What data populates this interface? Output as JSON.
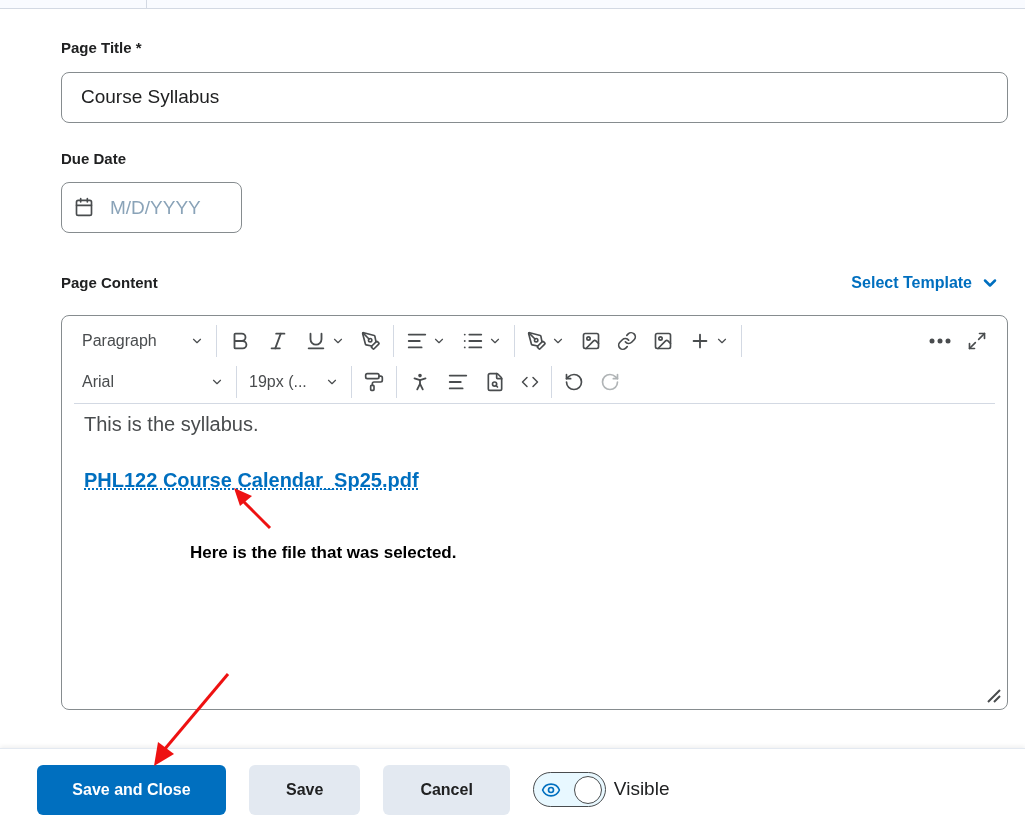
{
  "form": {
    "title_label": "Page Title",
    "required_mark": "*",
    "title_value": "Course Syllabus",
    "due_label": "Due Date",
    "due_placeholder": "M/D/YYYY",
    "content_label": "Page Content",
    "template_link": "Select Template"
  },
  "toolbar": {
    "block_format": "Paragraph",
    "font": "Arial",
    "size": "19px (..."
  },
  "editor": {
    "paragraph": "This is the syllabus.",
    "file_link": "PHL122 Course Calendar_Sp25.pdf",
    "annotation": "Here is the file that was selected."
  },
  "footer": {
    "buttons": [
      {
        "label": "Save and Close",
        "kind": "primary"
      },
      {
        "label": "Save",
        "kind": "secondary"
      },
      {
        "label": "Cancel",
        "kind": "secondary"
      }
    ],
    "visible_toggle": {
      "label": "Visible",
      "on": true
    }
  }
}
